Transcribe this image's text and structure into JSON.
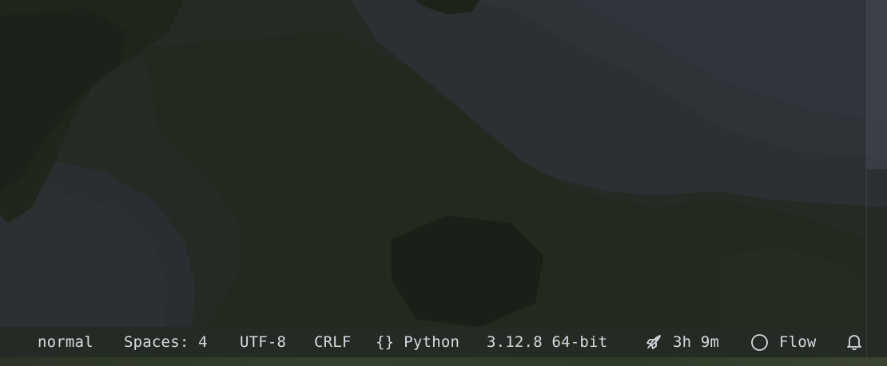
{
  "statusbar": {
    "mode": "normal",
    "indentation": "Spaces: 4",
    "encoding": "UTF-8",
    "line_ending": "CRLF",
    "language_icon": "braces-icon",
    "language": "Python",
    "interpreter": "3.12.8 64-bit",
    "timer_icon": "rocket-icon",
    "timer": "3h 9m",
    "flow_icon": "circle-icon",
    "flow": "Flow",
    "notifications_icon": "bell-icon"
  },
  "colors": {
    "statusbar_text": "#d6dbe0",
    "background_dark": "#1f2420",
    "background_grey": "#2c3034"
  }
}
